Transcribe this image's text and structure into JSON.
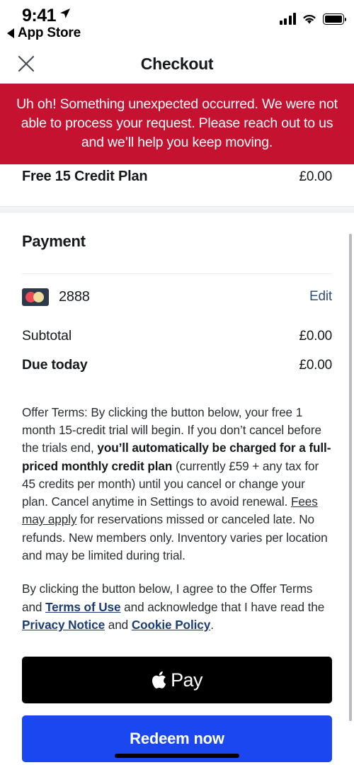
{
  "status_bar": {
    "time": "9:41",
    "location_icon": "location-arrow-icon",
    "back_label": "App Store",
    "signal_icon": "cellular-signal-icon",
    "wifi_icon": "wifi-icon",
    "battery_icon": "battery-full-icon"
  },
  "header": {
    "close_icon": "close-x-icon",
    "title": "Checkout"
  },
  "error_banner": {
    "message": "Uh oh! Something unexpected occurred. We were not able to process your request. Please reach out to us and we’ll help you keep moving.",
    "background_color": "#c41230",
    "text_color": "#ffffff"
  },
  "plan": {
    "name": "Free 15 Credit Plan",
    "price": "£0.00"
  },
  "payment": {
    "title": "Payment",
    "card": {
      "brand_icon": "mastercard-icon",
      "last_four": "2888",
      "edit_label": "Edit",
      "edit_color": "#2f4f78"
    },
    "totals": [
      {
        "label": "Subtotal",
        "value": "£0.00",
        "bold": false
      },
      {
        "label": "Due today",
        "value": "£0.00",
        "bold": true
      }
    ]
  },
  "terms": {
    "offer_1": "Offer Terms: By clicking the button below, your free 1 month 15-credit trial will begin. If you don’t cancel before the trials end, ",
    "offer_bold": "you’ll automatically be charged for a full-priced monthly credit plan",
    "offer_2": " (currently £59 + any tax for 45 credits per month) until you cancel or change your plan. Cancel anytime in Settings to avoid renewal. ",
    "fees_link": "Fees may apply",
    "offer_3": " for reservations missed or canceled late. No refunds. New members only. Inventory varies per location and may be limited during trial.",
    "consent_1": "By clicking the button below, I agree to the Offer Terms and ",
    "terms_of_use_link": "Terms of Use",
    "consent_2": " and acknowledge that I have read the ",
    "privacy_link": "Privacy Notice",
    "consent_3": " and ",
    "cookie_link": "Cookie Policy",
    "consent_4": "."
  },
  "actions": {
    "apple_pay_icon": "apple-logo-icon",
    "apple_pay_label": "Pay",
    "redeem_label": "Redeem now",
    "redeem_color": "#1a47f0"
  },
  "scrollbar": {
    "visible": true
  },
  "home_indicator": {
    "visible": true
  }
}
